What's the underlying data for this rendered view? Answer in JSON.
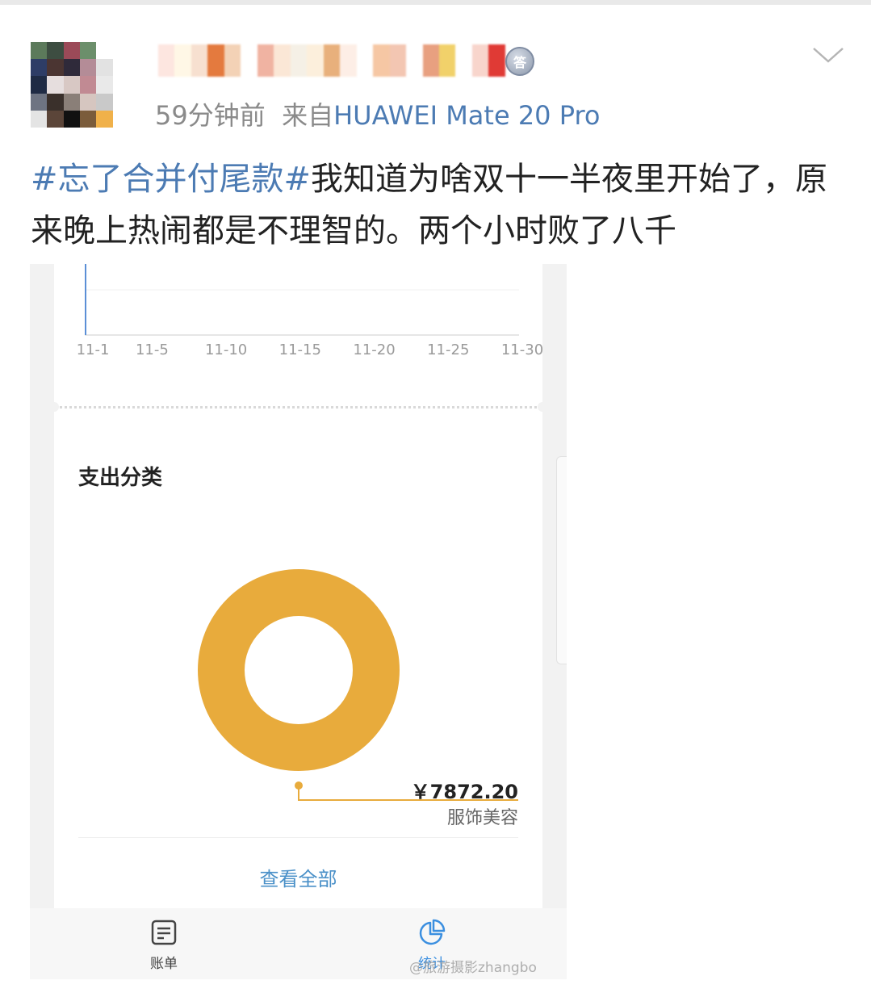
{
  "post": {
    "time": "59分钟前",
    "source_prefix": "来自",
    "source_device": "HUAWEI Mate 20 Pro",
    "medal_char": "答",
    "hashtag": "#忘了合并付尾款#",
    "text": "我知道为啥双十一半夜里开始了，原来晚上热闹都是不理智的。两个小时败了八千"
  },
  "app": {
    "chart_axis_labels": [
      "11-1",
      "11-5",
      "11-10",
      "11-15",
      "11-20",
      "11-25",
      "11-30"
    ],
    "section_title": "支出分类",
    "amount": "￥7872.20",
    "category": "服饰美容",
    "view_all": "查看全部",
    "tabs": {
      "bills": "账单",
      "stats": "统计"
    }
  },
  "chart_data": {
    "type": "pie",
    "title": "支出分类",
    "categories": [
      "服饰美容"
    ],
    "values": [
      7872.2
    ],
    "colors": [
      "#e8ab3c"
    ]
  },
  "colors": {
    "link": "#4c7bb3",
    "accent": "#3b8fe0",
    "donut": "#e8ab3c"
  },
  "watermark": "@旅游摄影zhangbo"
}
